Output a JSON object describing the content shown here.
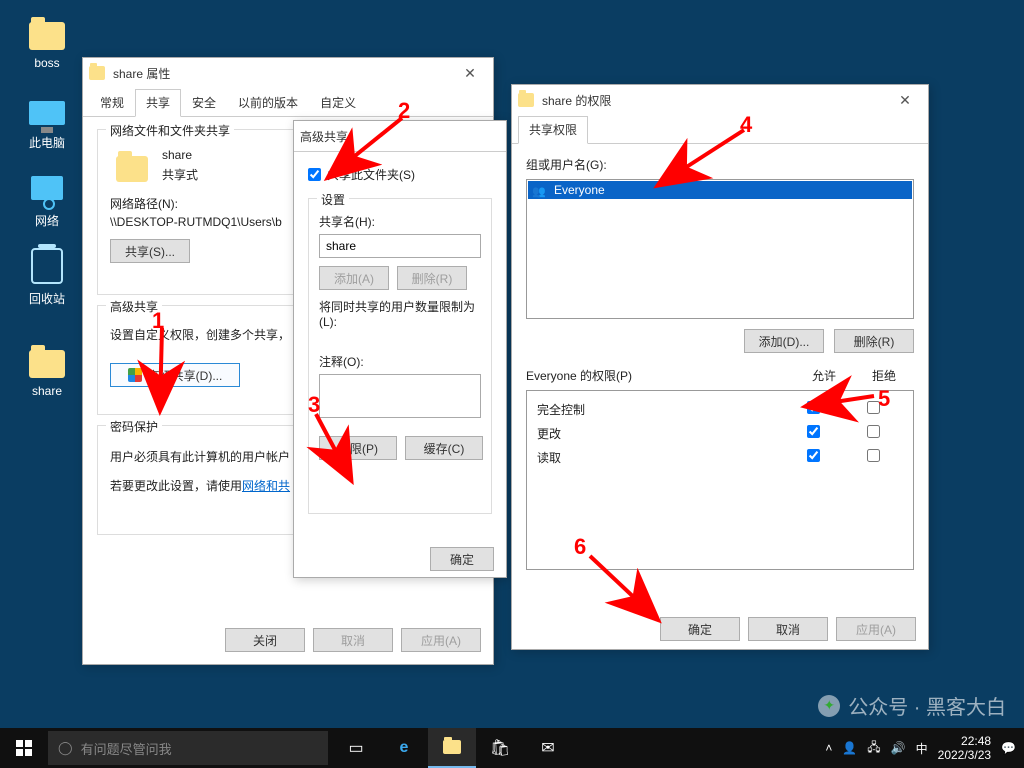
{
  "desktop": {
    "boss": "boss",
    "this_pc": "此电脑",
    "network": "网络",
    "recycle": "回收站",
    "share": "share"
  },
  "props_win": {
    "title": "share 属性",
    "tabs": {
      "general": "常规",
      "share": "共享",
      "security": "安全",
      "prev": "以前的版本",
      "custom": "自定义"
    },
    "g1_label": "网络文件和文件夹共享",
    "folder_name": "share",
    "share_state": "共享式",
    "netpath_lbl": "网络路径(N):",
    "netpath_val": "\\\\DESKTOP-RUTMDQ1\\Users\\b",
    "share_btn": "共享(S)...",
    "g2_label": "高级共享",
    "g2_text": "设置自定义权限，创建多个共享，",
    "adv_btn": "高级共享(D)...",
    "g3_label": "密码保护",
    "g3_text1": "用户必须具有此计算机的用户帐户",
    "g3_text2a": "若要更改此设置，请使用",
    "g3_link": "网络和共",
    "close_btn": "关闭",
    "cancel_btn": "取消",
    "apply_btn": "应用(A)"
  },
  "adv_win": {
    "title": "高级共享",
    "chk_label": "共享此文件夹(S)",
    "settings_label": "设置",
    "sharename_lbl": "共享名(H):",
    "sharename_val": "share",
    "add_btn": "添加(A)",
    "del_btn": "删除(R)",
    "limit_lbl": "将同时共享的用户数量限制为(L):",
    "notes_lbl": "注释(O):",
    "perm_btn": "权限(P)",
    "cache_btn": "缓存(C)",
    "ok_btn": "确定"
  },
  "perm_win": {
    "title": "share 的权限",
    "tab": "共享权限",
    "group_lbl": "组或用户名(G):",
    "everyone": "Everyone",
    "add_btn": "添加(D)...",
    "del_btn": "删除(R)",
    "perm_for": "Everyone 的权限(P)",
    "col_allow": "允许",
    "col_deny": "拒绝",
    "rows": {
      "full": "完全控制",
      "change": "更改",
      "read": "读取"
    },
    "ok_btn": "确定",
    "cancel_btn": "取消",
    "apply_btn": "应用(A)"
  },
  "annotations": {
    "n1": "1",
    "n2": "2",
    "n3": "3",
    "n4": "4",
    "n5": "5",
    "n6": "6"
  },
  "taskbar": {
    "search_placeholder": "有问题尽管问我",
    "time": "22:48",
    "date": "2022/3/23"
  },
  "watermark": "公众号 · 黑客大白"
}
